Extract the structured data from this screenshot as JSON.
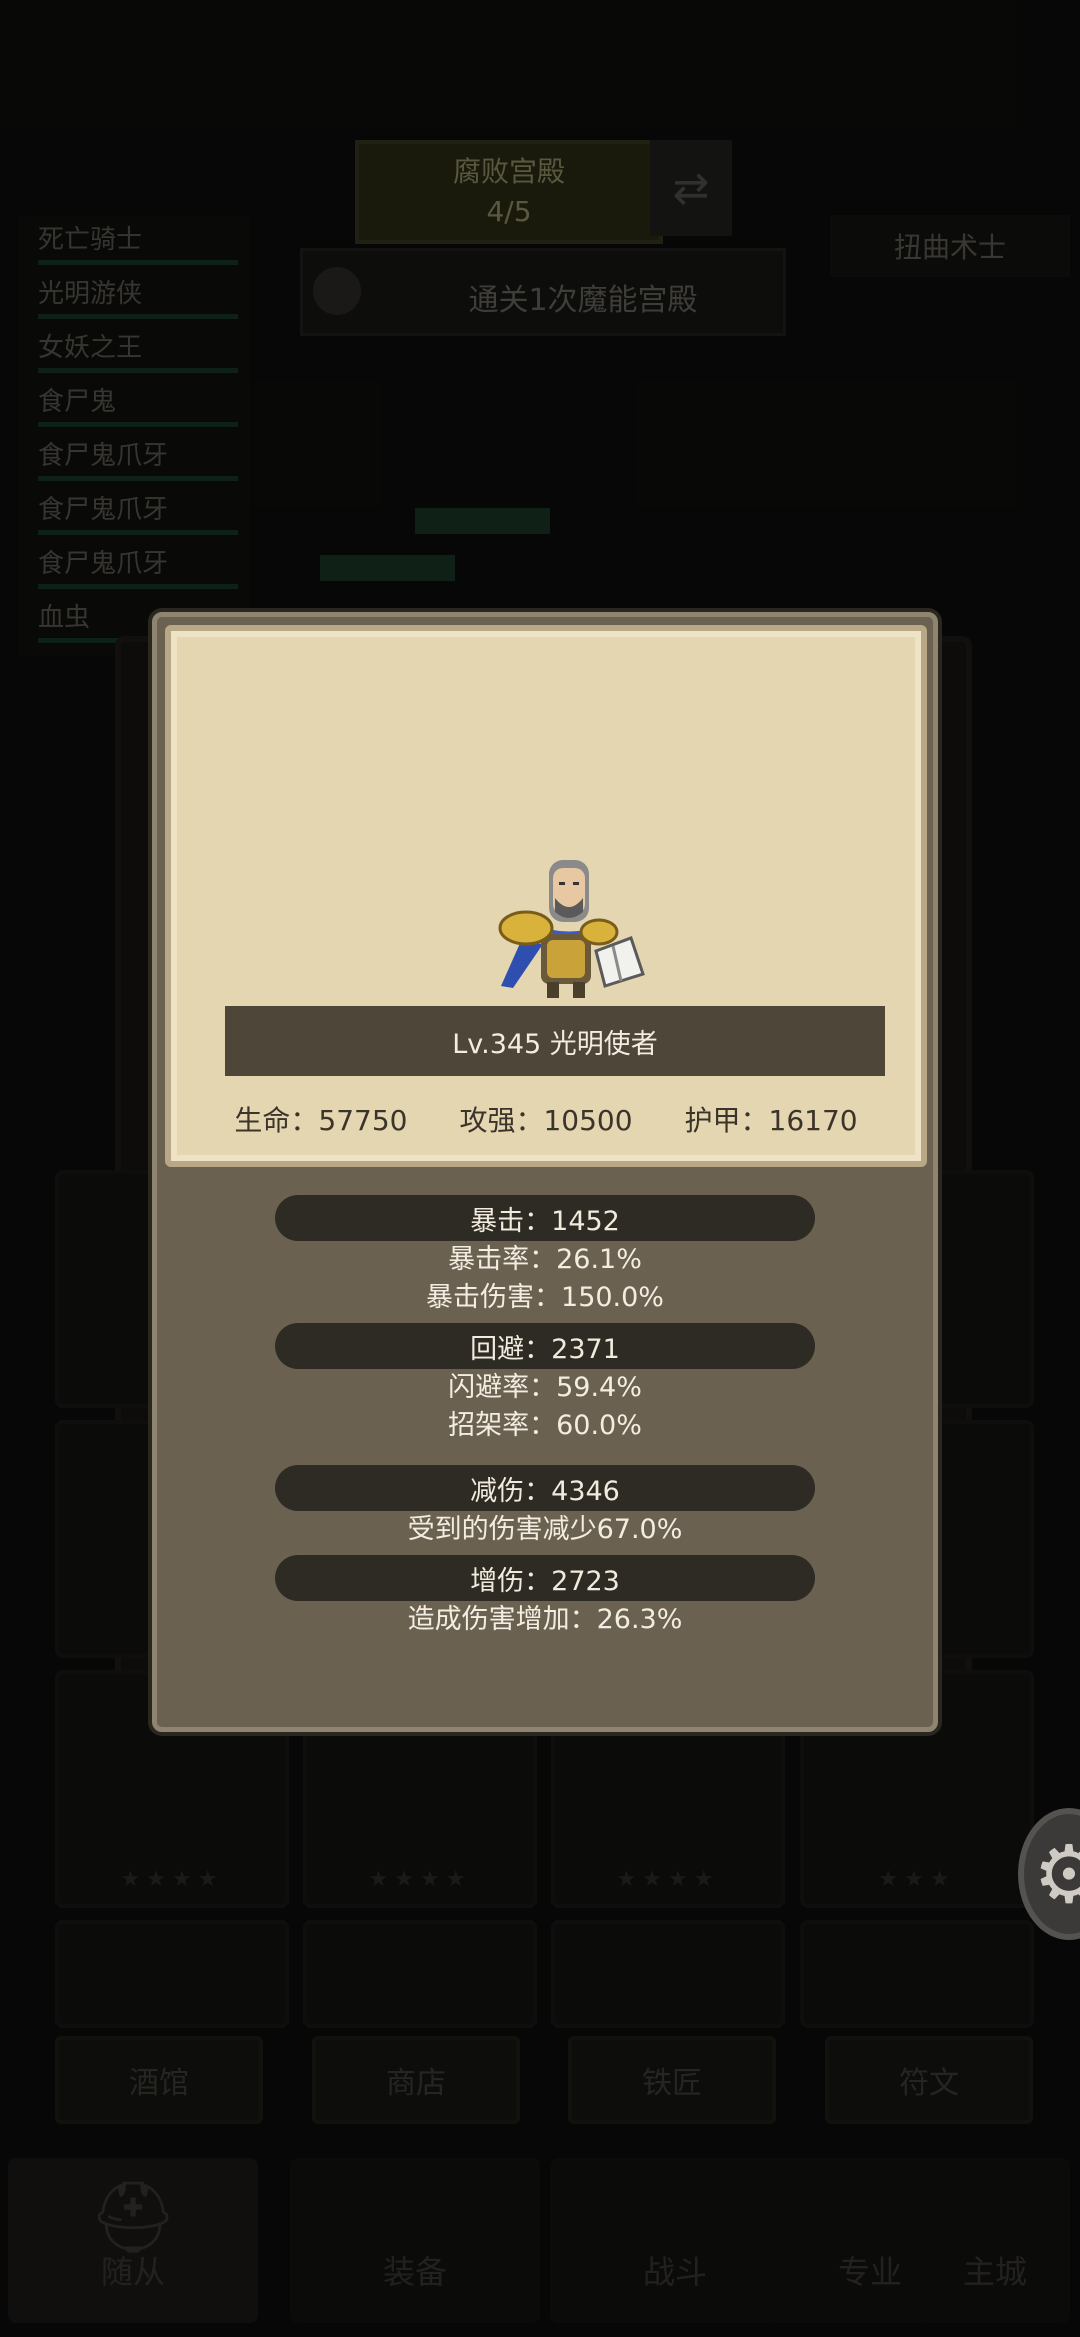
{
  "background": {
    "dungeon_title": "腐败宫殿",
    "dungeon_progress": "4/5",
    "quest_text": "通关1次魔能宫殿",
    "enemy_name": "扭曲术士",
    "unit_list": [
      "死亡骑士",
      "光明游侠",
      "女妖之王",
      "食尸鬼",
      "食尸鬼爪牙",
      "食尸鬼爪牙",
      "食尸鬼爪牙",
      "血虫"
    ],
    "sub_tabs": [
      "酒馆",
      "商店",
      "铁匠",
      "符文"
    ],
    "bottom_nav": [
      "随从",
      "装备",
      "战斗",
      "专业",
      "主城"
    ]
  },
  "hero": {
    "name_line": "Lv.345 光明使者",
    "hp": "生命：57750",
    "attack": "攻强：10500",
    "armor": "护甲：16170"
  },
  "stats": {
    "crit": {
      "title": "暴击：1452",
      "line1": "暴击率：26.1%",
      "line2": "暴击伤害：150.0%"
    },
    "dodge": {
      "title": "回避：2371",
      "line1": "闪避率：59.4%",
      "line2": "招架率：60.0%"
    },
    "reduction": {
      "title": "减伤：4346",
      "line1": "受到的伤害减少67.0%"
    },
    "increase": {
      "title": "增伤：2723",
      "line1": "造成伤害增加：26.3%"
    }
  },
  "colors": {
    "parchment": "#e5d6b2",
    "panel": "#6b6151",
    "banner": "#4e4639",
    "stat_bar": "#2e2a24"
  },
  "icons": [
    "settings-gear-icon",
    "swap-arrows-icon",
    "helmet-icon"
  ]
}
